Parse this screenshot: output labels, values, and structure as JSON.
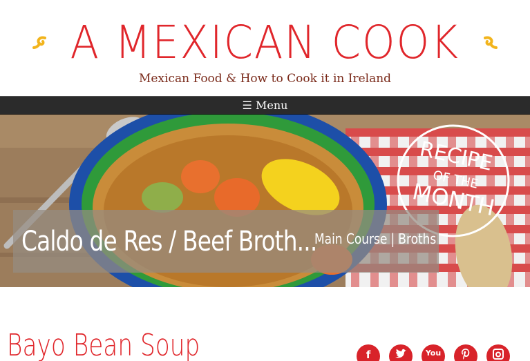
{
  "site": {
    "title": "A MEXICAN COOK",
    "tagline": "Mexican Food & How to Cook it in Ireland"
  },
  "nav": {
    "menu_label": "☰ Menu"
  },
  "hero": {
    "badge_text": "RECIPE OF THE MONTH",
    "caption_title": "Caldo de Res / Beef Broth...",
    "categories": [
      "Main Course",
      "Broths"
    ],
    "separator": "|"
  },
  "post": {
    "title": "Bayo Bean Soup"
  },
  "social": {
    "facebook_label": "f",
    "youtube_label": "You"
  },
  "colors": {
    "brand_red": "#e0262b",
    "swirl_gold": "#f2b41c",
    "menubar": "#2b2b2b"
  },
  "icons": [
    "swirl-icon",
    "facebook-icon",
    "twitter-icon",
    "youtube-icon",
    "pinterest-icon",
    "instagram-icon"
  ]
}
